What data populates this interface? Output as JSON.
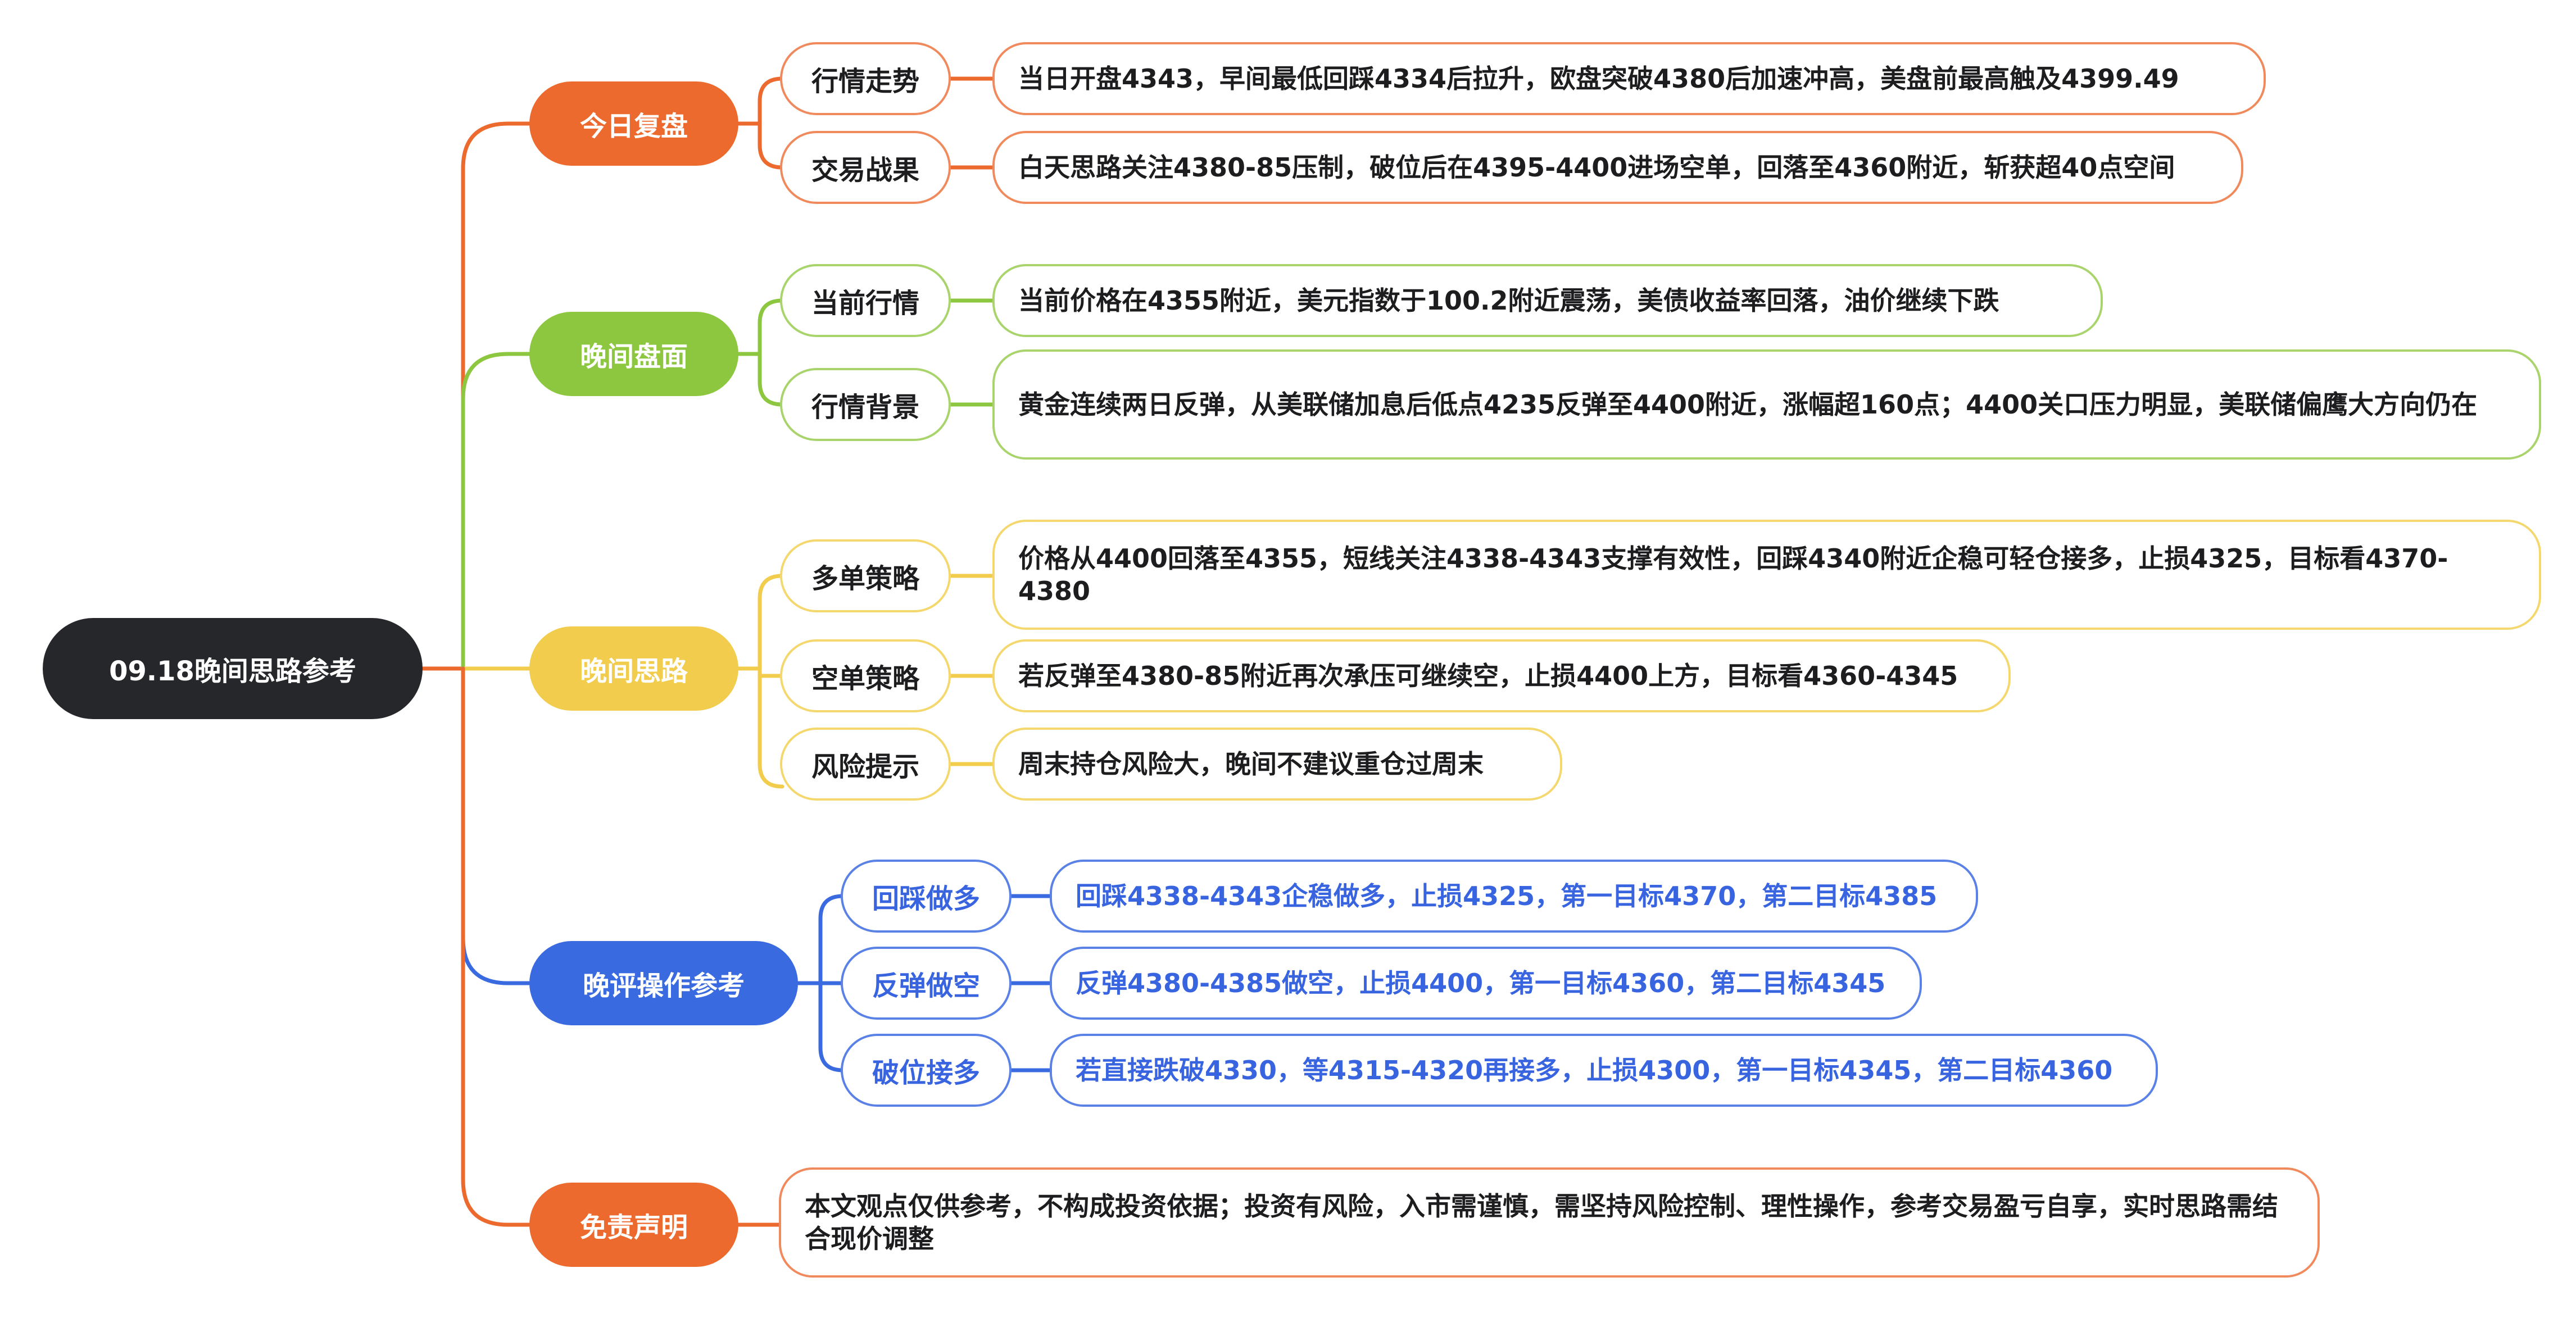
{
  "colors": {
    "root_bg": "#26272a",
    "orange": "#ec6a2e",
    "green": "#8dc63f",
    "yellow": "#f2cc4c",
    "blue": "#3a6ae0",
    "orange_border": "#f08a5d",
    "green_border": "#a8d46b",
    "yellow_border": "#f4d86e",
    "blue_border": "#5a82e6"
  },
  "root": {
    "label": "09.18晚间思路参考"
  },
  "branches": [
    {
      "label": "今日复盘",
      "color": "orange",
      "children": [
        {
          "label": "行情走势",
          "text": "当日开盘4343，早间最低回踩4334后拉升，欧盘突破4380后加速冲高，美盘前最高触及4399.49"
        },
        {
          "label": "交易战果",
          "text": "白天思路关注4380-85压制，破位后在4395-4400进场空单，回落至4360附近，斩获超40点空间"
        }
      ]
    },
    {
      "label": "晚间盘面",
      "color": "green",
      "children": [
        {
          "label": "当前行情",
          "text": "当前价格在4355附近，美元指数于100.2附近震荡，美债收益率回落，油价继续下跌"
        },
        {
          "label": "行情背景",
          "text": "黄金连续两日反弹，从美联储加息后低点4235反弹至4400附近，涨幅超160点；4400关口压力明显，美联储偏鹰大方向仍在"
        }
      ]
    },
    {
      "label": "晚间思路",
      "color": "yellow",
      "children": [
        {
          "label": "多单策略",
          "text": "价格从4400回落至4355，短线关注4338-4343支撑有效性，回踩4340附近企稳可轻仓接多，止损4325，目标看4370-4380"
        },
        {
          "label": "空单策略",
          "text": "若反弹至4380-85附近再次承压可继续空，止损4400上方，目标看4360-4345"
        },
        {
          "label": "风险提示",
          "text": "周末持仓风险大，晚间不建议重仓过周末"
        }
      ]
    },
    {
      "label": "晚评操作参考",
      "color": "blue",
      "children": [
        {
          "label": "回踩做多",
          "text": "回踩4338-4343企稳做多，止损4325，第一目标4370，第二目标4385"
        },
        {
          "label": "反弹做空",
          "text": "反弹4380-4385做空，止损4400，第一目标4360，第二目标4345"
        },
        {
          "label": "破位接多",
          "text": "若直接跌破4330，等4315-4320再接多，止损4300，第一目标4345，第二目标4360"
        }
      ]
    },
    {
      "label": "免责声明",
      "color": "orange",
      "text": "本文观点仅供参考，不构成投资依据；投资有风险，入市需谨慎，需坚持风险控制、理性操作，参考交易盈亏自享，实时思路需结合现价调整"
    }
  ]
}
